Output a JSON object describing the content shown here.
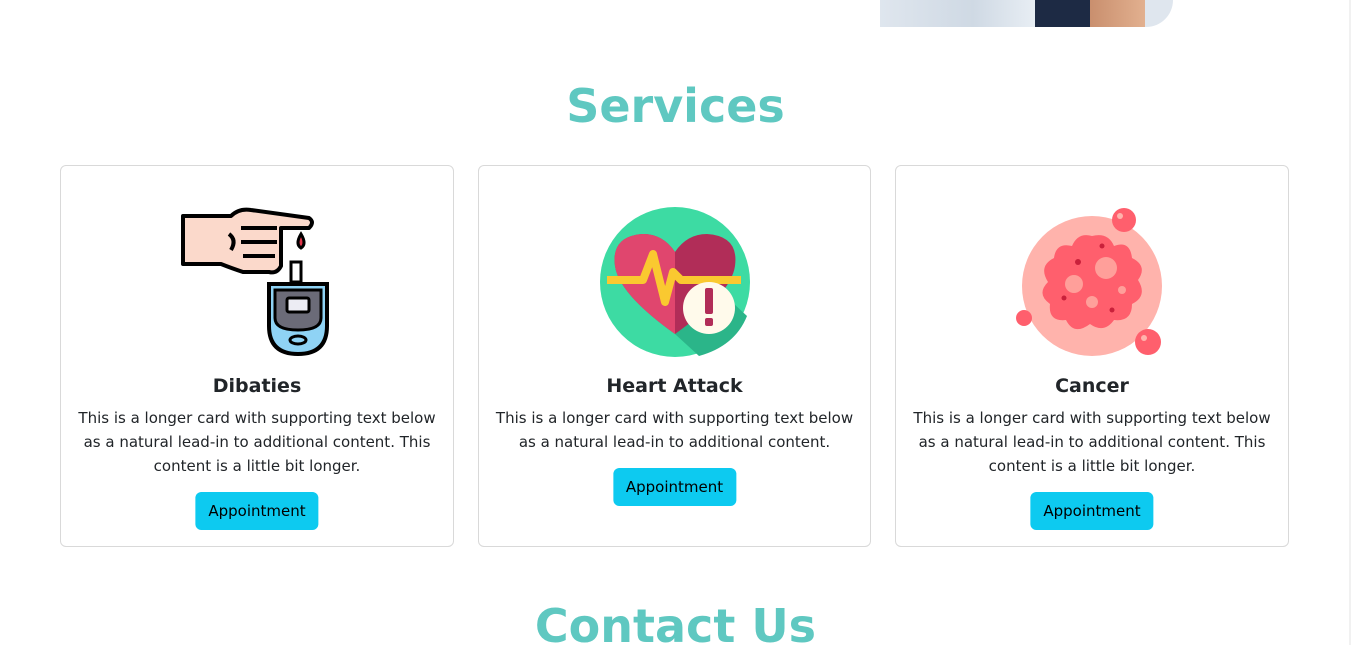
{
  "sections": {
    "services_title": "Services",
    "contact_title": "Contact Us"
  },
  "services": [
    {
      "title": "Dibaties",
      "text": "This is a longer card with supporting text below as a natural lead-in to additional content. This content is a little bit longer.",
      "button": "Appointment",
      "icon": "glucose-meter-icon"
    },
    {
      "title": "Heart Attack",
      "text": "This is a longer card with supporting text below as a natural lead-in to additional content.",
      "button": "Appointment",
      "icon": "heart-attack-icon"
    },
    {
      "title": "Cancer",
      "text": "This is a longer card with supporting text below as a natural lead-in to additional content. This content is a little bit longer.",
      "button": "Appointment",
      "icon": "cancer-cell-icon"
    }
  ],
  "colors": {
    "accent": "#5fc8c1",
    "button": "#0dcaf0",
    "card_border": "#d9d9d9"
  }
}
